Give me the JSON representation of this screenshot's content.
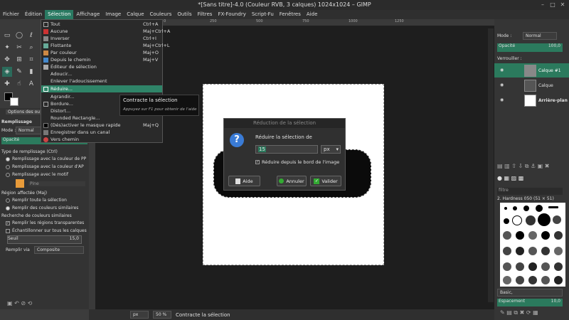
{
  "window": {
    "title": "*[Sans titre]-4.0 (Couleur RVB, 3 calques) 1024x1024 – GIMP"
  },
  "menubar": [
    "Fichier",
    "Édition",
    "Sélection",
    "Affichage",
    "Image",
    "Calque",
    "Couleurs",
    "Outils",
    "Filtres",
    "FX-Foundry",
    "Script-Fu",
    "Fenêtres",
    "Aide"
  ],
  "selection_menu": {
    "items": [
      {
        "label": "Tout",
        "shortcut": "Ctrl+A"
      },
      {
        "label": "Aucune",
        "shortcut": "Maj+Ctrl+A"
      },
      {
        "label": "Inverser",
        "shortcut": "Ctrl+I"
      },
      {
        "label": "Flottante",
        "shortcut": "Maj+Ctrl+L"
      },
      {
        "label": "Par couleur",
        "shortcut": "Maj+O"
      },
      {
        "label": "Depuis le chemin",
        "shortcut": "Maj+V"
      },
      {
        "label": "Éditeur de sélection",
        "shortcut": ""
      },
      {
        "label": "Adoucir...",
        "shortcut": ""
      },
      {
        "label": "Enlever l'adoucissement",
        "shortcut": ""
      },
      {
        "label": "Réduire...",
        "shortcut": ""
      },
      {
        "label": "Agrandir...",
        "shortcut": ""
      },
      {
        "label": "Bordure...",
        "shortcut": ""
      },
      {
        "label": "Distort...",
        "shortcut": ""
      },
      {
        "label": "Rounded Rectangle...",
        "shortcut": ""
      },
      {
        "label": "(Dés)activer le masque rapide",
        "shortcut": "Maj+Q"
      },
      {
        "label": "Enregistrer dans un canal",
        "shortcut": ""
      },
      {
        "label": "Vers chemin",
        "shortcut": ""
      }
    ]
  },
  "tooltip": {
    "title": "Contracte la sélection",
    "hint": "Appuyez sur F1 pour obtenir de l'aide"
  },
  "dialog": {
    "title": "Réduction de la sélection",
    "label": "Réduire la sélection de",
    "value": "15",
    "unit": "px",
    "checkbox_label": "Réduire depuis le bord de l'image",
    "buttons": {
      "help": "Aide",
      "cancel": "Annuler",
      "ok": "Valider"
    }
  },
  "tool_options": {
    "tab": "Options des ou",
    "title": "Remplissage",
    "mode_label": "Mode :",
    "mode_value": "Normal",
    "opacity_label": "Opacité",
    "fill_type_label": "Type de remplissage  (Ctrl)",
    "fill_types": [
      "Remplissage avec la couleur de PP",
      "Remplissage avec la couleur d'AP",
      "Remplissage avec le motif"
    ],
    "pattern_name": "Pine",
    "affected_label": "Région affectée  (Maj)",
    "affected": [
      "Remplir toute la sélection",
      "Remplir des couleurs similaires"
    ],
    "similar_label": "Recherche de couleurs similaires",
    "transparent_label": "Remplir les régions transparentes",
    "merged_label": "Échantillonner sur tous les calques",
    "threshold_label": "Seuil",
    "threshold_value": "15,0",
    "fillby_label": "Remplir via",
    "fillby_value": "Composite"
  },
  "layers": {
    "mode_label": "Mode :",
    "mode_value": "Normal",
    "opacity_label": "Opacité",
    "opacity_value": "100,0",
    "lock_label": "Verrouiller :",
    "items": [
      "Calque #1",
      "Calque",
      "Arrière-plan"
    ]
  },
  "brushes": {
    "filter_placeholder": "filtre",
    "current": "2. Hardness 050 (51 × 51)",
    "preset": "Basic,",
    "spacing_label": "Espacement",
    "spacing_value": "10,0"
  },
  "status": {
    "unit": "px",
    "zoom": "50 %",
    "message": "Contracte la sélection"
  },
  "rulers": {
    "h": [
      "0",
      "250",
      "500",
      "750",
      "1000",
      "1250"
    ]
  }
}
